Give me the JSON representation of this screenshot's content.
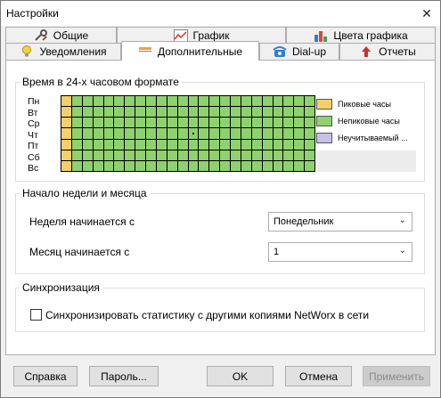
{
  "window": {
    "title": "Настройки",
    "close_glyph": "✕"
  },
  "tabs_row1": [
    {
      "label": "Общие",
      "icon": "tools-icon"
    },
    {
      "label": "График",
      "icon": "line-graph-icon"
    },
    {
      "label": "Цвета графика",
      "icon": "color-bars-icon"
    }
  ],
  "tabs_row2": [
    {
      "label": "Уведомления",
      "icon": "lightbulb-icon"
    },
    {
      "label": "Дополнительные",
      "icon": "advanced-icon",
      "selected": true
    },
    {
      "label": "Dial-up",
      "icon": "phone-icon"
    },
    {
      "label": "Отчеты",
      "icon": "report-arrow-icon"
    }
  ],
  "time_group": {
    "title": "Время в 24-х часовом формате",
    "days": [
      "Пн",
      "Вт",
      "Ср",
      "Чт",
      "Пт",
      "Сб",
      "Вс"
    ],
    "hours": 24,
    "peak_hours": [
      0
    ],
    "colors": {
      "peak": "#f5cf6b",
      "offpeak": "#8fd16f",
      "unmetered": "#c8c0e8"
    },
    "legend": {
      "peak": "Пиковые часы",
      "offpeak": "Непиковые часы",
      "unmetered": "Неучитываемый ..."
    }
  },
  "week_group": {
    "title": "Начало недели и месяца",
    "week_label": "Неделя начинается с",
    "week_value": "Понедельник",
    "month_label": "Месяц начинается с",
    "month_value": "1"
  },
  "sync_group": {
    "title": "Синхронизация",
    "checkbox_label": "Синхронизировать статистику с другими копиями NetWorx в сети",
    "checked": false
  },
  "buttons": {
    "help": "Справка",
    "password": "Пароль...",
    "ok": "OK",
    "cancel": "Отмена",
    "apply": "Применить"
  }
}
